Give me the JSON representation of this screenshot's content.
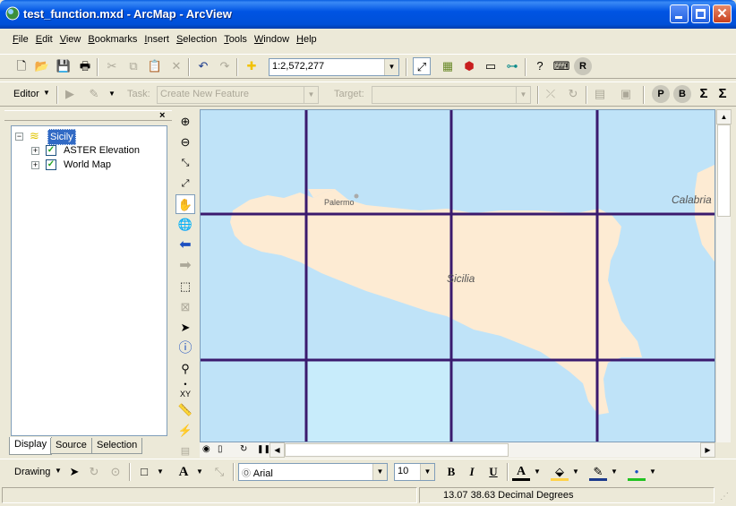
{
  "window": {
    "title": "test_function.mxd - ArcMap - ArcView"
  },
  "menu": [
    "File",
    "Edit",
    "View",
    "Bookmarks",
    "Insert",
    "Selection",
    "Tools",
    "Window",
    "Help"
  ],
  "standard_toolbar": {
    "scale": "1:2,572,277"
  },
  "editor_toolbar": {
    "editor_label": "Editor",
    "task_label": "Task:",
    "task_value": "Create New Feature",
    "target_label": "Target:",
    "target_value": "",
    "btn_p": "P",
    "btn_b": "B",
    "btn_sigma": "Σ"
  },
  "toc": {
    "dataframe": "Sicily",
    "layers": [
      {
        "name": "ASTER Elevation",
        "checked": true
      },
      {
        "name": "World Map",
        "checked": true
      }
    ],
    "tabs": [
      "Display",
      "Source",
      "Selection"
    ]
  },
  "map": {
    "labels": {
      "city": "Palermo",
      "region": "Sicilia",
      "mainland": "Calabria"
    },
    "colors": {
      "sea": "#bfe3f8",
      "land": "#fdebd3",
      "grid": "#3a1a6e",
      "tile": "#c8ecfb"
    }
  },
  "drawing_toolbar": {
    "drawing_label": "Drawing",
    "font": "Arial",
    "font_size": "10",
    "bold": "B",
    "italic": "I",
    "underline": "U",
    "text_a": "A"
  },
  "status": {
    "coords": "13.07  38.63 Decimal Degrees"
  }
}
